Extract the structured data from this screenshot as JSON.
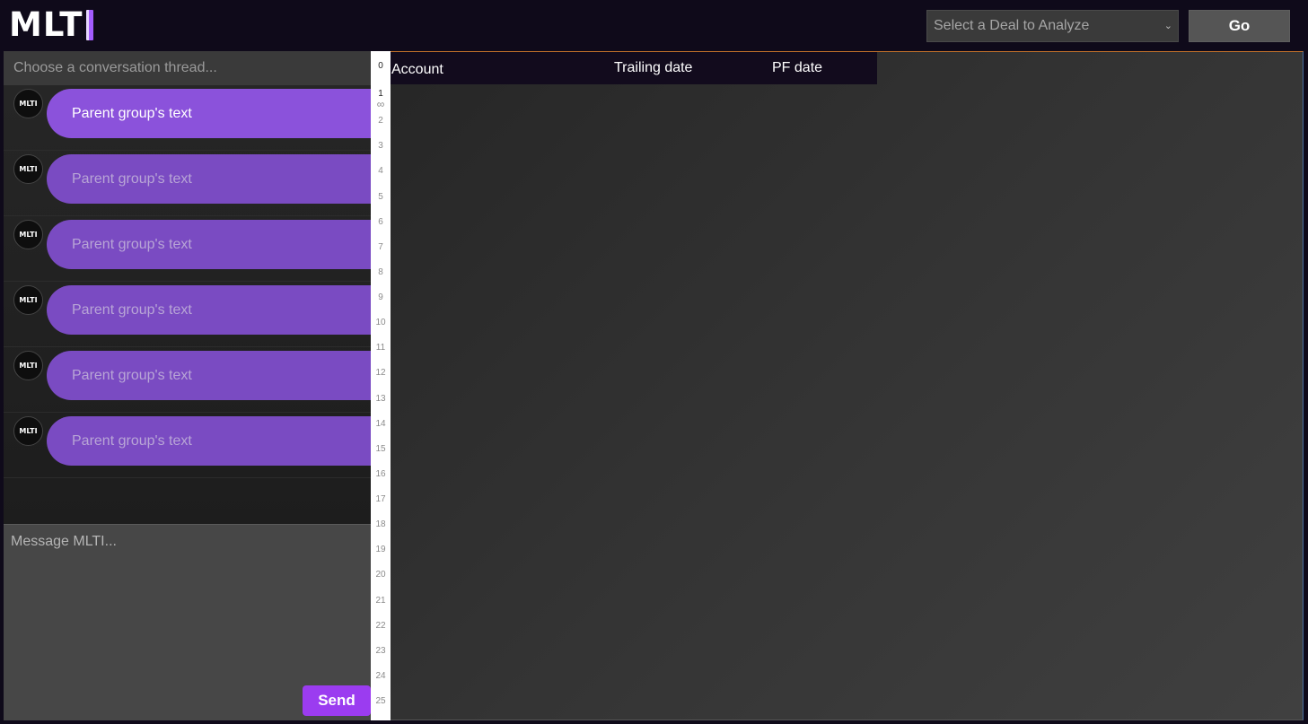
{
  "header": {
    "logo_text": "MLTI",
    "deal_select": {
      "selected": "Select a Deal to Analyze"
    },
    "go_label": "Go"
  },
  "chat": {
    "thread_picker_placeholder": "Choose a conversation thread...",
    "threads": [
      {
        "avatar": "MLTI",
        "text": "Parent group's text",
        "active": true
      },
      {
        "avatar": "MLTI",
        "text": "Parent group's text",
        "active": false
      },
      {
        "avatar": "MLTI",
        "text": "Parent group's text",
        "active": false
      },
      {
        "avatar": "MLTI",
        "text": "Parent group's text",
        "active": false
      },
      {
        "avatar": "MLTI",
        "text": "Parent group's text",
        "active": false
      },
      {
        "avatar": "MLTI",
        "text": "Parent group's text",
        "active": false
      }
    ],
    "composer_placeholder": "Message MLTI...",
    "send_label": "Send"
  },
  "gutter": {
    "rows": [
      "0",
      "1",
      "2",
      "3",
      "4",
      "5",
      "6",
      "7",
      "8",
      "9",
      "10",
      "11",
      "12",
      "13",
      "14",
      "15",
      "16",
      "17",
      "18",
      "19",
      "20",
      "21",
      "22",
      "23",
      "24",
      "25"
    ],
    "infinity_marker": "∞"
  },
  "grid": {
    "columns": [
      "Account",
      "Trailing date",
      "PF date"
    ]
  },
  "colors": {
    "accent": "#9b3cf0",
    "bubble_active": "#8b52db",
    "bubble": "#7a4bc2",
    "background": "#0f0a1a"
  }
}
